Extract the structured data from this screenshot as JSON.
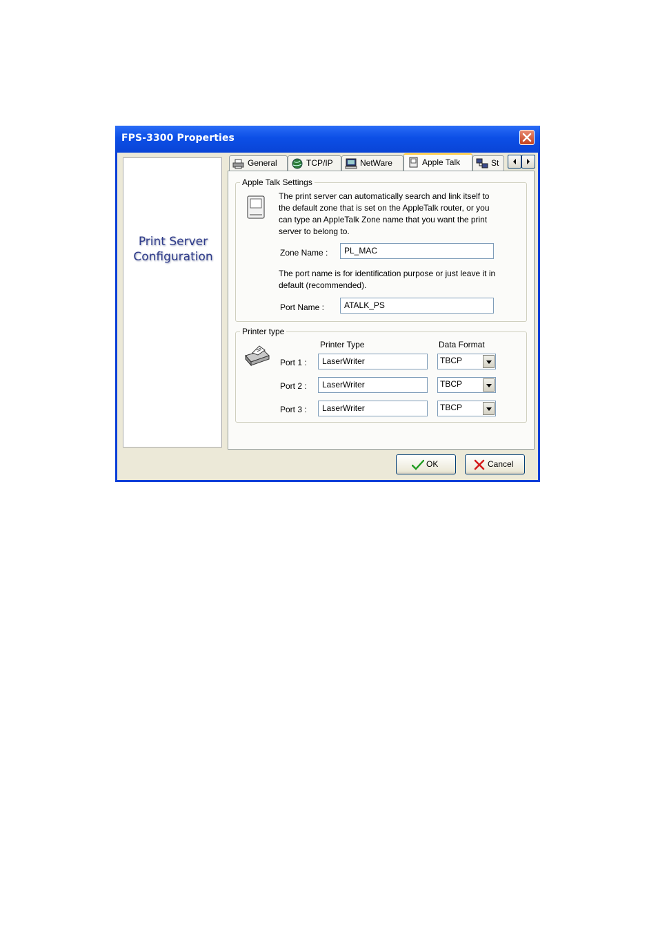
{
  "window": {
    "title": "FPS-3300 Properties"
  },
  "sidebar": {
    "brand_line1": "Print Server",
    "brand_line2": "Configuration"
  },
  "tabs": [
    {
      "label": "General",
      "icon": "printer-icon"
    },
    {
      "label": "TCP/IP",
      "icon": "globe-icon"
    },
    {
      "label": "NetWare",
      "icon": "computer-icon"
    },
    {
      "label": "Apple Talk",
      "icon": "mac-icon",
      "active": true
    },
    {
      "label": "St",
      "icon": "network-icon"
    }
  ],
  "apple_talk": {
    "group_label": "Apple Talk Settings",
    "description": [
      "The print server can automatically search and link itself to",
      "the default zone that is set on the AppleTalk router, or you",
      "can type an AppleTalk Zone name that you want the print",
      "server to belong to."
    ],
    "zone_name_label": "Zone Name :",
    "zone_name_value": "PL_MAC",
    "port_note": [
      "The port name is for identification purpose or just leave it in",
      "default (recommended)."
    ],
    "port_name_label": "Port Name :",
    "port_name_value": "ATALK_PS"
  },
  "printer_type": {
    "group_label": "Printer type",
    "col_printer_type": "Printer Type",
    "col_data_format": "Data Format",
    "ports": [
      {
        "label": "Port 1 :",
        "printer_type": "LaserWriter",
        "data_format": "TBCP"
      },
      {
        "label": "Port 2 :",
        "printer_type": "LaserWriter",
        "data_format": "TBCP"
      },
      {
        "label": "Port 3 :",
        "printer_type": "LaserWriter",
        "data_format": "TBCP"
      }
    ]
  },
  "buttons": {
    "ok": "OK",
    "cancel": "Cancel"
  },
  "colors": {
    "titlebar": "#0a44d6",
    "face": "#ece9d8",
    "accent_tab": "#ffc83c",
    "brand_text": "#2e3b8a"
  }
}
